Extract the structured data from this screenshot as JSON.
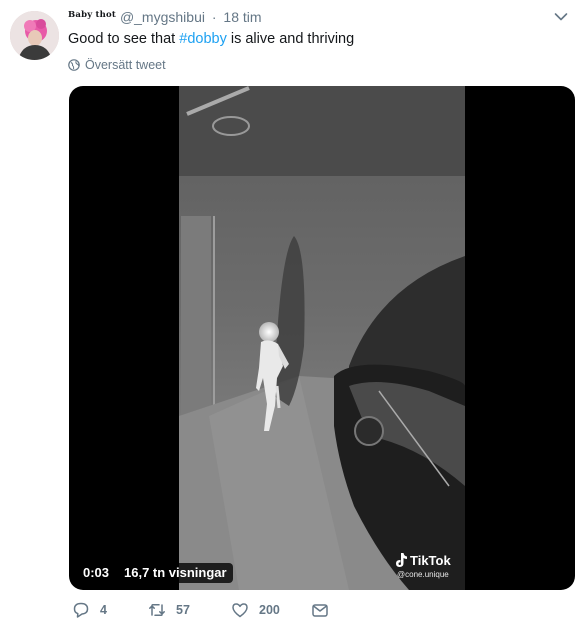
{
  "author": {
    "display_name": "Baby thot",
    "handle": "@_mygshibui",
    "separator": "·",
    "time": "18 tim"
  },
  "tweet": {
    "text_before": "Good to see that ",
    "hashtag": "#dobby",
    "text_after": " is alive and thriving",
    "translate_label": "Översätt tweet"
  },
  "video": {
    "elapsed": "0:03",
    "views": "16,7 tn visningar",
    "watermark_brand": "TikTok",
    "watermark_user": "@cone.unique"
  },
  "actions": {
    "reply_count": "4",
    "retweet_count": "57",
    "like_count": "200"
  },
  "colors": {
    "accent": "#1da1f2",
    "secondary_text": "#657786"
  }
}
